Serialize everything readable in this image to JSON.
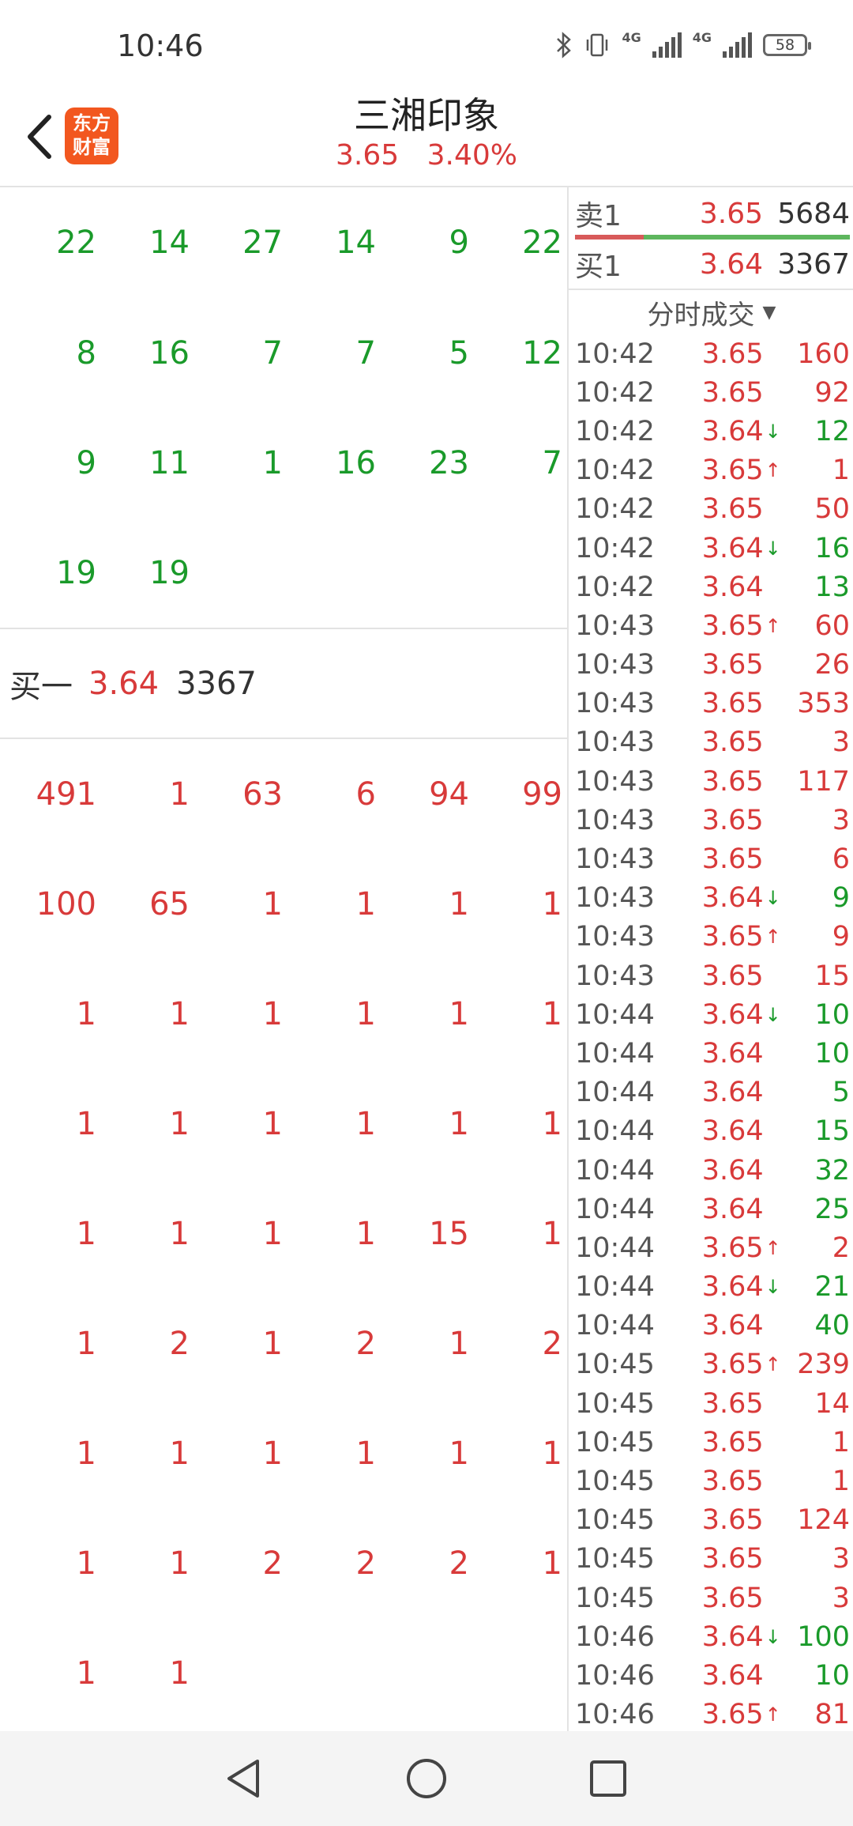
{
  "status_bar": {
    "time": "10:46",
    "network_label_1": "4G",
    "network_label_2": "4G",
    "battery": "58",
    "icons": [
      "bluetooth-icon",
      "vibrate-icon",
      "signal-icon",
      "signal-icon",
      "battery-icon"
    ]
  },
  "header": {
    "logo_line1": "东方",
    "logo_line2": "财富",
    "stock_name": "三湘印象",
    "price": "3.65",
    "change_pct": "3.40%"
  },
  "sell_grid": [
    [
      "22",
      "14",
      "27",
      "14",
      "9",
      "22"
    ],
    [
      "8",
      "16",
      "7",
      "7",
      "5",
      "12"
    ],
    [
      "9",
      "11",
      "1",
      "16",
      "23",
      "7"
    ],
    [
      "19",
      "19"
    ]
  ],
  "buy1": {
    "label": "买一",
    "price": "3.64",
    "volume": "3367"
  },
  "buy_grid": [
    [
      "491",
      "1",
      "63",
      "6",
      "94",
      "99"
    ],
    [
      "100",
      "65",
      "1",
      "1",
      "1",
      "1"
    ],
    [
      "1",
      "1",
      "1",
      "1",
      "1",
      "1"
    ],
    [
      "1",
      "1",
      "1",
      "1",
      "1",
      "1"
    ],
    [
      "1",
      "1",
      "1",
      "1",
      "15",
      "1"
    ],
    [
      "1",
      "2",
      "1",
      "2",
      "1",
      "2"
    ],
    [
      "1",
      "1",
      "1",
      "1",
      "1",
      "1"
    ],
    [
      "1",
      "1",
      "2",
      "2",
      "2",
      "1"
    ],
    [
      "1",
      "1"
    ]
  ],
  "order_book": {
    "sell1": {
      "label": "卖1",
      "price": "3.65",
      "volume": "5684"
    },
    "buy1": {
      "label": "买1",
      "price": "3.64",
      "volume": "3367"
    },
    "bar_sell_fraction": 0.25
  },
  "trades_header": "分时成交",
  "trades": [
    {
      "time": "10:42",
      "price": "3.65",
      "dir": "",
      "vol": "160",
      "color": "red"
    },
    {
      "time": "10:42",
      "price": "3.65",
      "dir": "",
      "vol": "92",
      "color": "red"
    },
    {
      "time": "10:42",
      "price": "3.64",
      "dir": "down",
      "vol": "12",
      "color": "green"
    },
    {
      "time": "10:42",
      "price": "3.65",
      "dir": "up",
      "vol": "1",
      "color": "red"
    },
    {
      "time": "10:42",
      "price": "3.65",
      "dir": "",
      "vol": "50",
      "color": "red"
    },
    {
      "time": "10:42",
      "price": "3.64",
      "dir": "down",
      "vol": "16",
      "color": "green"
    },
    {
      "time": "10:42",
      "price": "3.64",
      "dir": "",
      "vol": "13",
      "color": "green"
    },
    {
      "time": "10:43",
      "price": "3.65",
      "dir": "up",
      "vol": "60",
      "color": "red"
    },
    {
      "time": "10:43",
      "price": "3.65",
      "dir": "",
      "vol": "26",
      "color": "red"
    },
    {
      "time": "10:43",
      "price": "3.65",
      "dir": "",
      "vol": "353",
      "color": "red"
    },
    {
      "time": "10:43",
      "price": "3.65",
      "dir": "",
      "vol": "3",
      "color": "red"
    },
    {
      "time": "10:43",
      "price": "3.65",
      "dir": "",
      "vol": "117",
      "color": "red"
    },
    {
      "time": "10:43",
      "price": "3.65",
      "dir": "",
      "vol": "3",
      "color": "red"
    },
    {
      "time": "10:43",
      "price": "3.65",
      "dir": "",
      "vol": "6",
      "color": "red"
    },
    {
      "time": "10:43",
      "price": "3.64",
      "dir": "down",
      "vol": "9",
      "color": "green"
    },
    {
      "time": "10:43",
      "price": "3.65",
      "dir": "up",
      "vol": "9",
      "color": "red"
    },
    {
      "time": "10:43",
      "price": "3.65",
      "dir": "",
      "vol": "15",
      "color": "red"
    },
    {
      "time": "10:44",
      "price": "3.64",
      "dir": "down",
      "vol": "10",
      "color": "green"
    },
    {
      "time": "10:44",
      "price": "3.64",
      "dir": "",
      "vol": "10",
      "color": "green"
    },
    {
      "time": "10:44",
      "price": "3.64",
      "dir": "",
      "vol": "5",
      "color": "green"
    },
    {
      "time": "10:44",
      "price": "3.64",
      "dir": "",
      "vol": "15",
      "color": "green"
    },
    {
      "time": "10:44",
      "price": "3.64",
      "dir": "",
      "vol": "32",
      "color": "green"
    },
    {
      "time": "10:44",
      "price": "3.64",
      "dir": "",
      "vol": "25",
      "color": "green"
    },
    {
      "time": "10:44",
      "price": "3.65",
      "dir": "up",
      "vol": "2",
      "color": "red"
    },
    {
      "time": "10:44",
      "price": "3.64",
      "dir": "down",
      "vol": "21",
      "color": "green"
    },
    {
      "time": "10:44",
      "price": "3.64",
      "dir": "",
      "vol": "40",
      "color": "green"
    },
    {
      "time": "10:45",
      "price": "3.65",
      "dir": "up",
      "vol": "239",
      "color": "red"
    },
    {
      "time": "10:45",
      "price": "3.65",
      "dir": "",
      "vol": "14",
      "color": "red"
    },
    {
      "time": "10:45",
      "price": "3.65",
      "dir": "",
      "vol": "1",
      "color": "red"
    },
    {
      "time": "10:45",
      "price": "3.65",
      "dir": "",
      "vol": "1",
      "color": "red"
    },
    {
      "time": "10:45",
      "price": "3.65",
      "dir": "",
      "vol": "124",
      "color": "red"
    },
    {
      "time": "10:45",
      "price": "3.65",
      "dir": "",
      "vol": "3",
      "color": "red"
    },
    {
      "time": "10:45",
      "price": "3.65",
      "dir": "",
      "vol": "3",
      "color": "red"
    },
    {
      "time": "10:46",
      "price": "3.64",
      "dir": "down",
      "vol": "100",
      "color": "green"
    },
    {
      "time": "10:46",
      "price": "3.64",
      "dir": "",
      "vol": "10",
      "color": "green"
    },
    {
      "time": "10:46",
      "price": "3.65",
      "dir": "up",
      "vol": "81",
      "color": "red"
    }
  ],
  "colors": {
    "up_red": "#d83a3a",
    "down_green": "#1a9a2a",
    "logo_orange": "#f2571f"
  },
  "nav_bar": {
    "icons": [
      "nav-back-icon",
      "nav-home-icon",
      "nav-recent-icon"
    ]
  }
}
